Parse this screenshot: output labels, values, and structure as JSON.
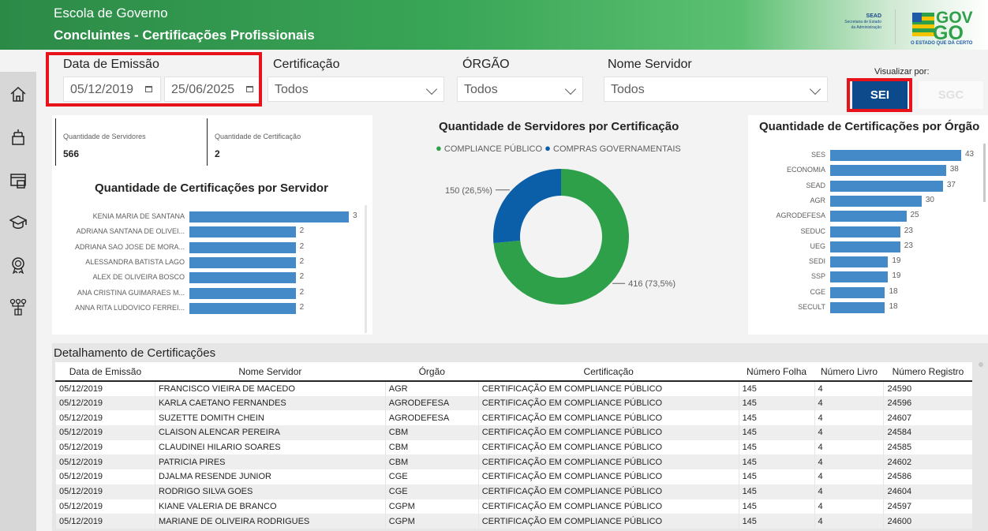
{
  "header": {
    "subtitle": "Escola de Governo",
    "title": "Concluintes - Certificações Profissionais",
    "sead": {
      "name": "SEAD",
      "line1": "Secretaria de Estado",
      "line2": "da Administração"
    },
    "logo": {
      "text_top": "GOV",
      "text_bottom": "GO",
      "tagline": "O ESTADO QUE DÁ CERTO"
    }
  },
  "sidebar": {
    "icons": [
      "home-icon",
      "idea-icon",
      "dashboard-icon",
      "graduation-cap-icon",
      "certificate-badge-icon",
      "network-icon"
    ]
  },
  "filters": {
    "date": {
      "label": "Data de Emissão",
      "start": "05/12/2019",
      "end": "25/06/2025"
    },
    "certificacao": {
      "label": "Certificação",
      "value": "Todos"
    },
    "orgao": {
      "label": "ÓRGÃO",
      "value": "Todos"
    },
    "servidor": {
      "label": "Nome Servidor",
      "value": "Todos"
    }
  },
  "view_toggle": {
    "label": "Visualizar por:",
    "sei": "SEI",
    "sgc": "SGC"
  },
  "cards": [
    {
      "label": "Quantidade de Servidores",
      "value": "566"
    },
    {
      "label": "Quantidade de Certificação",
      "value": "2"
    }
  ],
  "colors": {
    "bar": "#4489c8",
    "green": "#2fa04a",
    "blue": "#0a5fa8",
    "highlight": "#e8131a",
    "sei_button": "#0c4a8c"
  },
  "chart_data": [
    {
      "type": "bar",
      "title": "Quantidade de Certificações por Servidor",
      "orientation": "horizontal",
      "categories": [
        "KENIA MARIA DE SANTANA",
        "ADRIANA SANTANA DE OLIVEI...",
        "ADRIANA SAO JOSE DE MORA...",
        "ALESSANDRA BATISTA LAGO",
        "ALEX DE OLIVEIRA BOSCO",
        "ANA CRISTINA GUIMARAES M...",
        "ANNA RITA LUDOVICO FERREI..."
      ],
      "values": [
        3,
        2,
        2,
        2,
        2,
        2,
        2
      ]
    },
    {
      "type": "pie",
      "title": "Quantidade de Servidores por Certificação",
      "legend": [
        "COMPLIANCE PÚBLICO",
        "COMPRAS GOVERNAMENTAIS"
      ],
      "values": [
        416,
        150
      ],
      "labels": [
        "416 (73,5%)",
        "150 (26,5%)"
      ]
    },
    {
      "type": "bar",
      "title": "Quantidade de Certificações por Órgão",
      "orientation": "horizontal",
      "categories": [
        "SES",
        "ECONOMIA",
        "SEAD",
        "AGR",
        "AGRODEFESA",
        "SEDUC",
        "UEG",
        "SEDI",
        "SSP",
        "CGE",
        "SECULT"
      ],
      "values": [
        43,
        38,
        37,
        30,
        25,
        23,
        23,
        19,
        19,
        18,
        18
      ]
    }
  ],
  "table": {
    "title": "Detalhamento de Certificações",
    "columns": [
      "Data de Emissão",
      "Nome Servidor",
      "Órgão",
      "Certificação",
      "Número Folha",
      "Número Livro",
      "Número Registro"
    ],
    "rows": [
      [
        "05/12/2019",
        "FRANCISCO VIEIRA DE MACEDO",
        "AGR",
        "CERTIFICAÇÃO EM COMPLIANCE PÚBLICO",
        "145",
        "4",
        "24590"
      ],
      [
        "05/12/2019",
        "KARLA CAETANO FERNANDES",
        "AGRODEFESA",
        "CERTIFICAÇÃO EM COMPLIANCE PÚBLICO",
        "145",
        "4",
        "24596"
      ],
      [
        "05/12/2019",
        "SUZETTE DOMITH CHEIN",
        "AGRODEFESA",
        "CERTIFICAÇÃO EM COMPLIANCE PÚBLICO",
        "145",
        "4",
        "24607"
      ],
      [
        "05/12/2019",
        "CLAISON ALENCAR PEREIRA",
        "CBM",
        "CERTIFICAÇÃO EM COMPLIANCE PÚBLICO",
        "145",
        "4",
        "24584"
      ],
      [
        "05/12/2019",
        "CLAUDINEI HILARIO SOARES",
        "CBM",
        "CERTIFICAÇÃO EM COMPLIANCE PÚBLICO",
        "145",
        "4",
        "24585"
      ],
      [
        "05/12/2019",
        "PATRICIA PIRES",
        "CBM",
        "CERTIFICAÇÃO EM COMPLIANCE PÚBLICO",
        "145",
        "4",
        "24602"
      ],
      [
        "05/12/2019",
        "DJALMA RESENDE JUNIOR",
        "CGE",
        "CERTIFICAÇÃO EM COMPLIANCE PÚBLICO",
        "145",
        "4",
        "24586"
      ],
      [
        "05/12/2019",
        "RODRIGO SILVA GOES",
        "CGE",
        "CERTIFICAÇÃO EM COMPLIANCE PÚBLICO",
        "145",
        "4",
        "24604"
      ],
      [
        "05/12/2019",
        "KIANE VALERIA DE BRANCO",
        "CGPM",
        "CERTIFICAÇÃO EM COMPLIANCE PÚBLICO",
        "145",
        "4",
        "24597"
      ],
      [
        "05/12/2019",
        "MARIANE DE OLIVEIRA RODRIGUES",
        "CGPM",
        "CERTIFICAÇÃO EM COMPLIANCE PÚBLICO",
        "145",
        "4",
        "24600"
      ]
    ]
  }
}
